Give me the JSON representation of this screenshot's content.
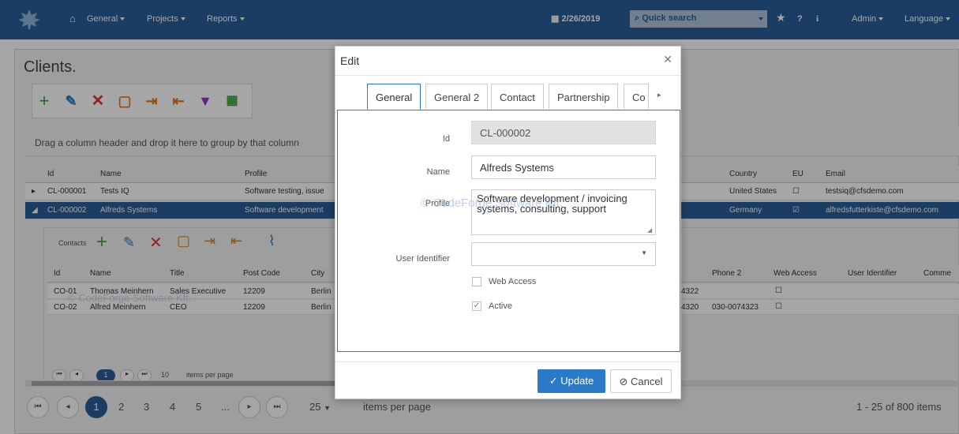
{
  "topbar": {
    "nav": [
      {
        "label": "General"
      },
      {
        "label": "Projects"
      },
      {
        "label": "Reports"
      }
    ],
    "date": "2/26/2019",
    "search_placeholder": "Quick search",
    "info_icon_label": "i",
    "help_icon_label": "?",
    "user": "Admin",
    "language": "Language"
  },
  "page": {
    "title": "Clients."
  },
  "grid": {
    "group_hint": "Drag a column header and drop it here to group by that column",
    "columns": [
      "Id",
      "Name",
      "Profile",
      "Country",
      "EU",
      "Email"
    ],
    "rows": [
      {
        "id": "CL-000001",
        "name": "Tests IQ",
        "profile": "Software testing, issue",
        "country": "United States",
        "email": "testsiq@cfsdemo.com"
      },
      {
        "id": "CL-000002",
        "name": "Alfreds Systems",
        "profile": "Software development",
        "country": "Germany",
        "email": "alfredsfutterkiste@cfsdemo.com"
      }
    ]
  },
  "contacts": {
    "label": "Contacts",
    "columns": [
      "Id",
      "Name",
      "Title",
      "Post Code",
      "City",
      "Phone 2",
      "Web Access",
      "User Identifier",
      "Comme"
    ],
    "rows": [
      {
        "id": "CO-01",
        "name": "Thomas Meinhern",
        "title": "Sales Executive",
        "post_code": "12209",
        "city": "Berlin",
        "phone1_tail": "4322",
        "phone2": ""
      },
      {
        "id": "CO-02",
        "name": "Alfred Meinhern",
        "title": "CEO",
        "post_code": "12209",
        "city": "Berlin",
        "phone1_tail": "4320",
        "phone2": "030-0074323"
      }
    ],
    "pager_size": "10",
    "pager_text": "items per page",
    "pager_page": "1"
  },
  "pager": {
    "pages": [
      "1",
      "2",
      "3",
      "4",
      "5",
      "..."
    ],
    "page_size": "25",
    "items_label": "items per page",
    "summary": "1 - 25 of 800 items"
  },
  "watermark": "© CodeForge Software Kft.",
  "dialog": {
    "title": "Edit",
    "tabs": [
      "General",
      "General 2",
      "Contact",
      "Partnership",
      "Co"
    ],
    "fields": {
      "id_label": "Id",
      "id_value": "CL-000002",
      "name_label": "Name",
      "name_value": "Alfreds Systems",
      "profile_label": "Profile",
      "profile_value": "Software development / invoicing systems, consulting, support",
      "user_identifier_label": "User Identifier",
      "user_identifier_value": "",
      "web_access_label": "Web Access",
      "web_access_checked": false,
      "active_label": "Active",
      "active_checked": true
    },
    "update_label": "Update",
    "cancel_label": "Cancel"
  },
  "colors": {
    "header": "#2a5f98",
    "accent": "#2a7ac7",
    "add": "#3ea23e",
    "delete": "#d43b3b",
    "export": "#e57c1c",
    "filter": "#8e3cc7"
  }
}
